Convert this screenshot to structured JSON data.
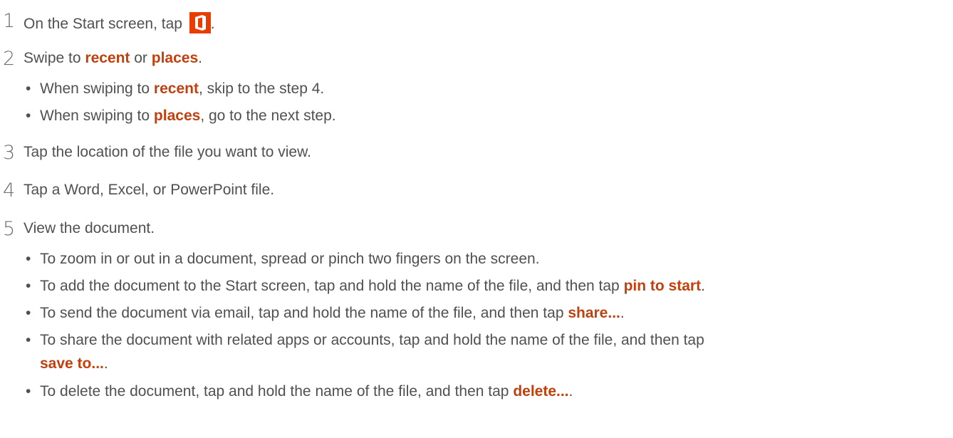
{
  "steps": [
    {
      "number": "1",
      "text_before": "On the Start screen, tap",
      "text_after": "."
    },
    {
      "number": "2",
      "text_a": "Swipe to ",
      "kw_a": "recent",
      "text_b": " or ",
      "kw_b": "places",
      "text_c": "."
    },
    {
      "number": "3",
      "text": "Tap the location of the file you want to view."
    },
    {
      "number": "4",
      "text": "Tap a Word, Excel, or PowerPoint file."
    },
    {
      "number": "5",
      "text": "View the document."
    }
  ],
  "step2_bullets": [
    {
      "a": "When swiping to ",
      "kw": "recent",
      "b": ", skip to the step 4."
    },
    {
      "a": "When swiping to ",
      "kw": "places",
      "b": ", go to the next step."
    }
  ],
  "step5_bullets": [
    {
      "a": "To zoom in or out in a document, spread or pinch two fingers on the screen.",
      "kw": "",
      "b": ""
    },
    {
      "a": "To add the document to the Start screen, tap and hold the name of the file, and then tap ",
      "kw": "pin to start",
      "b": "."
    },
    {
      "a": "To send the document via email, tap and hold the name of the file, and then tap ",
      "kw": "share...",
      "b": "."
    },
    {
      "a": "To share the document with related apps or accounts, tap and hold the name of the file, and then tap",
      "kw2": "save to...",
      "b2": "."
    },
    {
      "a": "To delete the document, tap and hold the name of the file, and then tap ",
      "kw": "delete...",
      "b": "."
    }
  ],
  "icons": {
    "office": "office-icon",
    "office_color": "#eb3c00"
  },
  "colors": {
    "keyword": "#c0410e",
    "text": "#505050"
  }
}
